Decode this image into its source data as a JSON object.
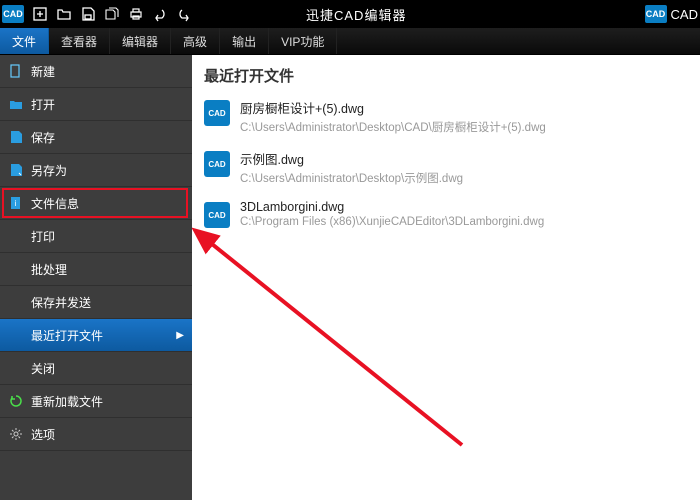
{
  "app": {
    "title": "迅捷CAD编辑器",
    "logo_text": "CAD",
    "right_badge": "CAD"
  },
  "menubar": {
    "tabs": [
      "文件",
      "查看器",
      "编辑器",
      "高级",
      "输出",
      "VIP功能"
    ]
  },
  "sidebar": {
    "items": [
      {
        "icon": "new",
        "label": "新建"
      },
      {
        "icon": "open",
        "label": "打开"
      },
      {
        "icon": "save",
        "label": "保存"
      },
      {
        "icon": "saveas",
        "label": "另存为"
      },
      {
        "icon": "info",
        "label": "文件信息"
      },
      {
        "icon": "none",
        "label": "打印"
      },
      {
        "icon": "none",
        "label": "批处理"
      },
      {
        "icon": "none",
        "label": "保存并发送"
      },
      {
        "icon": "recent",
        "label": "最近打开文件",
        "active": true,
        "arrow": true
      },
      {
        "icon": "none",
        "label": "关闭"
      },
      {
        "icon": "reload",
        "label": "重新加载文件"
      },
      {
        "icon": "options",
        "label": "选项"
      }
    ],
    "highlighted_index": 4
  },
  "main": {
    "heading": "最近打开文件",
    "files": [
      {
        "name": "厨房橱柜设计+(5).dwg",
        "path": "C:\\Users\\Administrator\\Desktop\\CAD\\厨房橱柜设计+(5).dwg"
      },
      {
        "name": "示例图.dwg",
        "path": "C:\\Users\\Administrator\\Desktop\\示例图.dwg"
      },
      {
        "name": "3DLamborgini.dwg",
        "path": "C:\\Program Files (x86)\\XunjieCADEditor\\3DLamborgini.dwg"
      }
    ]
  }
}
